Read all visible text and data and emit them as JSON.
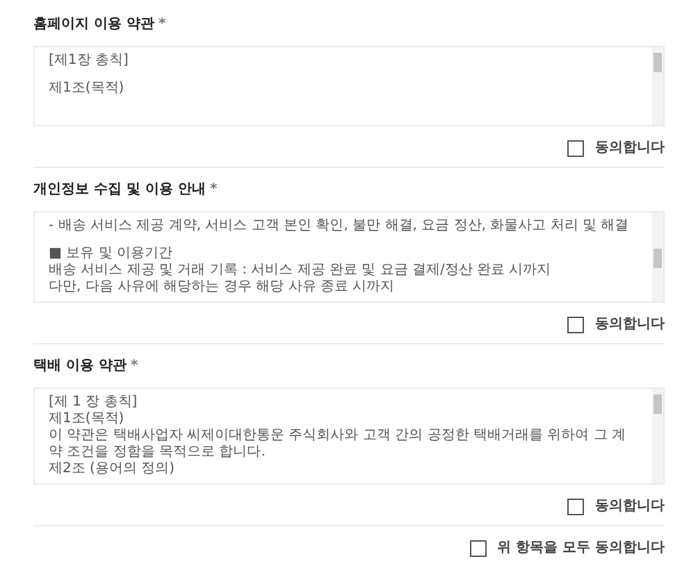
{
  "sections": [
    {
      "title": "홈페이지 이용 약관",
      "required": "*",
      "lines": [
        {
          "kind": "small",
          "text": "[제1장 총칙]"
        },
        {
          "kind": "gap"
        },
        {
          "kind": "text",
          "text": "제1조(목적)"
        }
      ],
      "agree": {
        "label": "동의합니다",
        "checked": false
      }
    },
    {
      "title": "개인정보 수집 및 이용 안내",
      "required": "*",
      "lines": [
        {
          "kind": "text",
          "text": "- 배송 서비스 제공 계약, 서비스 고객 본인 확인, 불만 해결, 요금 정산, 화물사고 처리 및 해결"
        },
        {
          "kind": "gap"
        },
        {
          "kind": "text",
          "text": "■ 보유 및 이용기간"
        },
        {
          "kind": "text",
          "text": "배송 서비스 제공 및 거래 기록 : 서비스 제공 완료 및 요금 결제/정산 완료 시까지"
        },
        {
          "kind": "text",
          "text": "다만, 다음 사유에 해당하는 경우 해당 사유 종료 시까지"
        }
      ],
      "agree": {
        "label": "동의합니다",
        "checked": false
      }
    },
    {
      "title": "택배 이용 약관",
      "required": "*",
      "lines": [
        {
          "kind": "small",
          "text": "[제 1 장 총칙]"
        },
        {
          "kind": "text",
          "text": "제1조(목적)"
        },
        {
          "kind": "text",
          "text": "이 약관은 택배사업자 씨제이대한통운 주식회사와 고객 간의 공정한 택배거래를 위하여 그 계약 조건을 정함을 목적으로 합니다."
        },
        {
          "kind": "text",
          "text": "제2조 (용어의 정의)"
        }
      ],
      "agree": {
        "label": "동의합니다",
        "checked": false
      }
    }
  ],
  "agree_all": {
    "label": "위 항목을 모두 동의합니다",
    "checked": false
  }
}
